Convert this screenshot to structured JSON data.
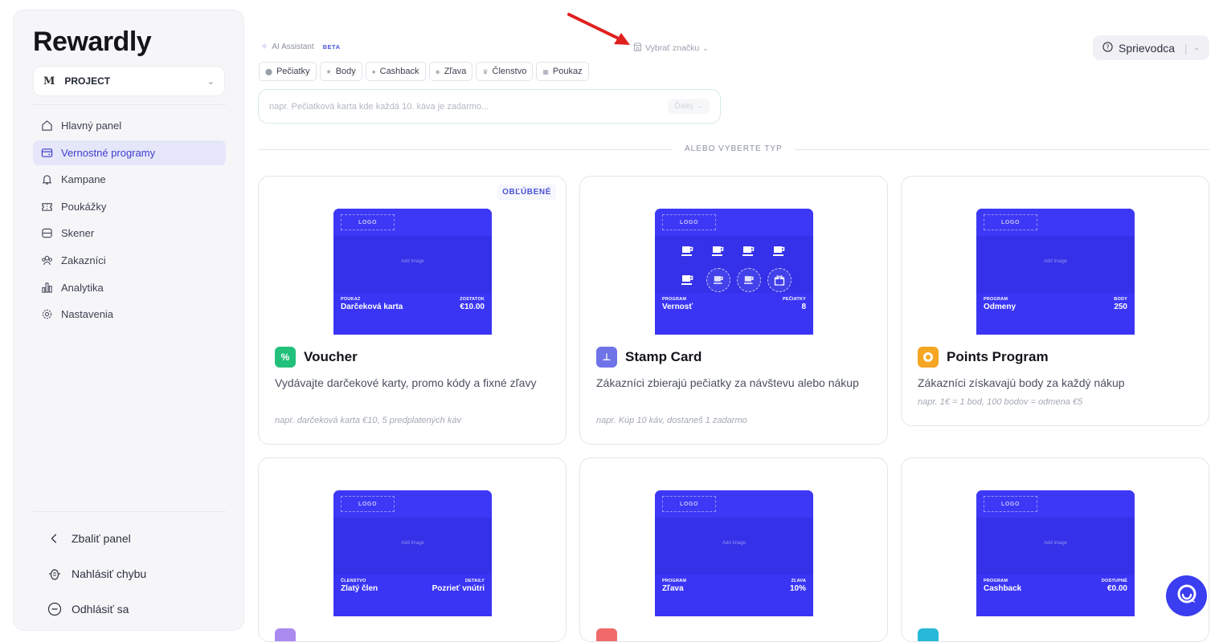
{
  "sidebar": {
    "logo": "Rewardly",
    "project": {
      "monogram": "M",
      "name": "PROJECT"
    },
    "items": [
      {
        "label": "Hlavný panel",
        "icon": "home-icon",
        "active": false
      },
      {
        "label": "Vernostné programy",
        "icon": "card-icon",
        "active": true
      },
      {
        "label": "Kampane",
        "icon": "bell-icon",
        "active": false
      },
      {
        "label": "Poukážky",
        "icon": "ticket-icon",
        "active": false
      },
      {
        "label": "Skener",
        "icon": "scanner-icon",
        "active": false
      },
      {
        "label": "Zakazníci",
        "icon": "users-icon",
        "active": false
      },
      {
        "label": "Analytika",
        "icon": "chart-icon",
        "active": false
      },
      {
        "label": "Nastavenia",
        "icon": "gear-icon",
        "active": false
      }
    ],
    "bottom": [
      {
        "label": "Zbaliť panel",
        "icon": "chevron-left-icon"
      },
      {
        "label": "Nahlásiť chybu",
        "icon": "bug-icon"
      },
      {
        "label": "Odhlásiť sa",
        "icon": "logout-icon"
      }
    ]
  },
  "topbar": {
    "ai_label": "AI Assistant",
    "beta": "BETA",
    "brand_select": "Vybrať značku",
    "guide": "Sprievodca"
  },
  "chips": [
    "Pečiatky",
    "Body",
    "Cashback",
    "Zľava",
    "Členstvo",
    "Poukaz"
  ],
  "prompt": {
    "placeholder": "napr. Pečiatková karta kde každá 10. káva je zadarmo...",
    "next": "Ďalej →"
  },
  "divider": "ALEBO VYBERTE TYP",
  "preview_common": {
    "logo": "LOGO",
    "add_image": "Add Image"
  },
  "cards": [
    {
      "title": "Voucher",
      "badge_color": "#22c07a",
      "favorite": "OBĽÚBENÉ",
      "desc": "Vydávajte darčekové karty, promo kódy a fixné zľavy",
      "example": "napr. darčeková karta €10, 5 predplatených káv",
      "left_key": "POUKAZ",
      "left_val": "Darčeková karta",
      "right_key": "ZOSTATOK",
      "right_val": "€10.00"
    },
    {
      "title": "Stamp Card",
      "badge_color": "#6f73e8",
      "desc": "Zákazníci zbierajú pečiatky za návštevu alebo nákup",
      "example": "napr. Kúp 10 káv, dostaneš 1 zadarmo",
      "left_key": "PROGRAM",
      "left_val": "Vernosť",
      "right_key": "PEČIATKY",
      "right_val": "8"
    },
    {
      "title": "Points Program",
      "badge_color": "#f5a623",
      "desc": "Zákazníci získavajú body za každý nákup",
      "example": "napr. 1€ = 1 bod, 100 bodov = odmena €5",
      "left_key": "PROGRAM",
      "left_val": "Odmeny",
      "right_key": "BODY",
      "right_val": "250"
    },
    {
      "left_key": "ČLENSTVO",
      "left_val": "Zlatý člen",
      "right_key": "DETAILY",
      "right_val": "Pozrieť vnútri",
      "badge_color": "#a98bf0"
    },
    {
      "left_key": "PROGRAM",
      "left_val": "Zľava",
      "right_key": "ZĽAVA",
      "right_val": "10%",
      "badge_color": "#f06a6a"
    },
    {
      "left_key": "PROGRAM",
      "left_val": "Cashback",
      "right_key": "DOSTUPNÉ",
      "right_val": "€0.00",
      "badge_color": "#28b8d8"
    }
  ],
  "colors": {
    "accent": "#3a35f5",
    "active_nav_bg": "#e6e6fa",
    "active_nav_text": "#3e3ecc"
  }
}
